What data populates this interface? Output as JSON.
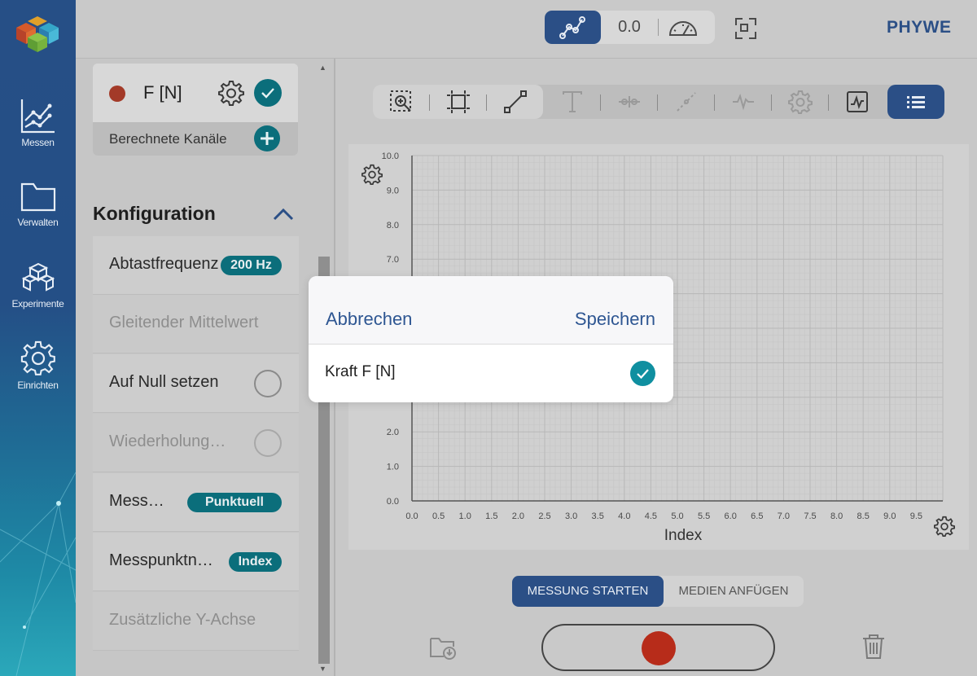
{
  "app": {
    "brand": "PHYWE",
    "accent_color": "#2b4f86",
    "teal_color": "#0b6e7b"
  },
  "sidebar": {
    "items": [
      {
        "label": "Messen",
        "icon": "chart-line-icon"
      },
      {
        "label": "Verwalten",
        "icon": "folder-icon"
      },
      {
        "label": "Experimente",
        "icon": "cubes-icon"
      },
      {
        "label": "Einrichten",
        "icon": "gear-icon"
      }
    ]
  },
  "topbar": {
    "value_display": "0.0",
    "modes": [
      "graph-icon",
      "value",
      "gauge-icon"
    ]
  },
  "channels": {
    "channel_label": "F [N]",
    "channel_color": "#a33a28",
    "calculated_channels_label": "Berechnete Kanäle"
  },
  "config": {
    "title": "Konfiguration",
    "rows": [
      {
        "label": "Abtastfrequenz",
        "badge": "200 Hz"
      },
      {
        "label": "Gleitender Mittelwert"
      },
      {
        "label": "Auf Null setzen"
      },
      {
        "label": "Wiederholung…"
      },
      {
        "label": "Mess…",
        "badge": "Punktuell"
      },
      {
        "label": "Messpunktn…",
        "badge": "Index"
      },
      {
        "label": "Zusätzliche Y-Achse"
      }
    ]
  },
  "toolbar": {
    "icons": [
      "zoom-in-icon",
      "fit-icon",
      "line-icon",
      "text-icon",
      "markers-icon",
      "tangent-icon",
      "signal-icon",
      "settings-icon",
      "analysis-icon",
      "list-icon"
    ]
  },
  "chart_data": {
    "type": "line",
    "xlabel": "Index",
    "ylabel": "",
    "xlim": [
      0,
      10
    ],
    "ylim": [
      0,
      10
    ],
    "x_ticks": [
      "0.0",
      "0.5",
      "1.0",
      "1.5",
      "2.0",
      "2.5",
      "3.0",
      "3.5",
      "4.0",
      "4.5",
      "5.0",
      "5.5",
      "6.0",
      "6.5",
      "7.0",
      "7.5",
      "8.0",
      "8.5",
      "9.0",
      "9.5"
    ],
    "y_ticks": [
      "0.0",
      "1.0",
      "2.0",
      "7.0",
      "8.0",
      "9.0",
      "10.0"
    ],
    "y_tick_values": [
      0,
      1,
      2,
      7,
      8,
      9,
      10
    ],
    "grid": true,
    "series": []
  },
  "bottom": {
    "start_label": "MESSUNG STARTEN",
    "media_label": "MEDIEN ANFÜGEN"
  },
  "modal": {
    "cancel_label": "Abbrechen",
    "save_label": "Speichern",
    "item_label": "Kraft F [N]",
    "item_checked": true
  }
}
